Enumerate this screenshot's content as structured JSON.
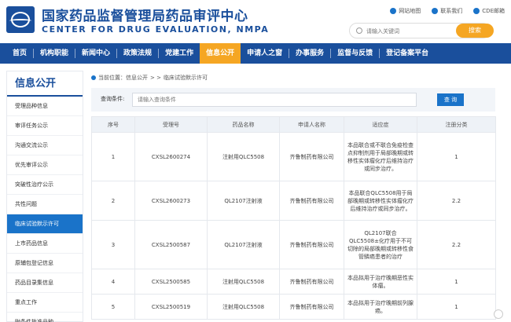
{
  "header": {
    "title_cn": "国家药品监督管理局药品审评中心",
    "title_en": "CENTER FOR DRUG EVALUATION, NMPA",
    "links": [
      "网站地图",
      "联系我们",
      "CDE邮箱"
    ],
    "search_placeholder": "请输入关键词",
    "search_button": "搜索"
  },
  "nav": {
    "items": [
      "首页",
      "机构职能",
      "新闻中心",
      "政策法规",
      "党建工作",
      "信息公开",
      "申请人之窗",
      "办事服务",
      "监督与反馈",
      "登记备案平台"
    ],
    "active_index": 5
  },
  "sidebar": {
    "title": "信息公开",
    "items": [
      "受理品种信息",
      "审评任务公示",
      "沟通交流公示",
      "优先审评公示",
      "突破性治疗公示",
      "共性问题",
      "临床试验默示许可",
      "上市药品信息",
      "原辅包登记信息",
      "药品目录集信息",
      "重点工作",
      "附条件批准品种"
    ],
    "active_index": 6
  },
  "breadcrumb": {
    "prefix": "当前位置：信息公开",
    "sep": "> >",
    "current": "临床试验默示许可"
  },
  "query": {
    "label": "查询条件:",
    "placeholder": "请输入查询条件",
    "button": "查 询"
  },
  "table": {
    "headers": [
      "序号",
      "受理号",
      "药品名称",
      "申请人名称",
      "适应症",
      "注册分类"
    ],
    "rows": [
      {
        "no": "1",
        "id": "CXSL2600274",
        "drug": "注射用QLC5508",
        "applicant": "齐鲁制药有限公司",
        "indication": "本品联合或不联合免疫检查点抑制剂用于局部晚期或转移性实体瘤化疗后维持治疗或同步治疗。",
        "category": "1"
      },
      {
        "no": "2",
        "id": "CXSL2600273",
        "drug": "QL2107注射液",
        "applicant": "齐鲁制药有限公司",
        "indication": "本品联合QLC5508用于局部晚期或转移性实体瘤化疗后维持治疗或同步治疗。",
        "category": "2.2"
      },
      {
        "no": "3",
        "id": "CXSL2500587",
        "drug": "QL2107注射液",
        "applicant": "齐鲁制药有限公司",
        "indication": "QL2107联合QLC5508±化疗用于不可切除的局部晚期或转移性食管鳞癌患者的治疗",
        "category": "2.2"
      },
      {
        "no": "4",
        "id": "CXSL2500585",
        "drug": "注射用QLC5508",
        "applicant": "齐鲁制药有限公司",
        "indication": "本品拟用于治疗晚期恶性实体瘤。",
        "category": "1"
      },
      {
        "no": "5",
        "id": "CXSL2500519",
        "drug": "注射用QLC5508",
        "applicant": "齐鲁制药有限公司",
        "indication": "本品拟用于治疗晚期前列腺癌。",
        "category": "1"
      }
    ]
  },
  "colors": {
    "brand": "#1a4f9c",
    "accent": "#f5a623",
    "link": "#1a73c9"
  }
}
